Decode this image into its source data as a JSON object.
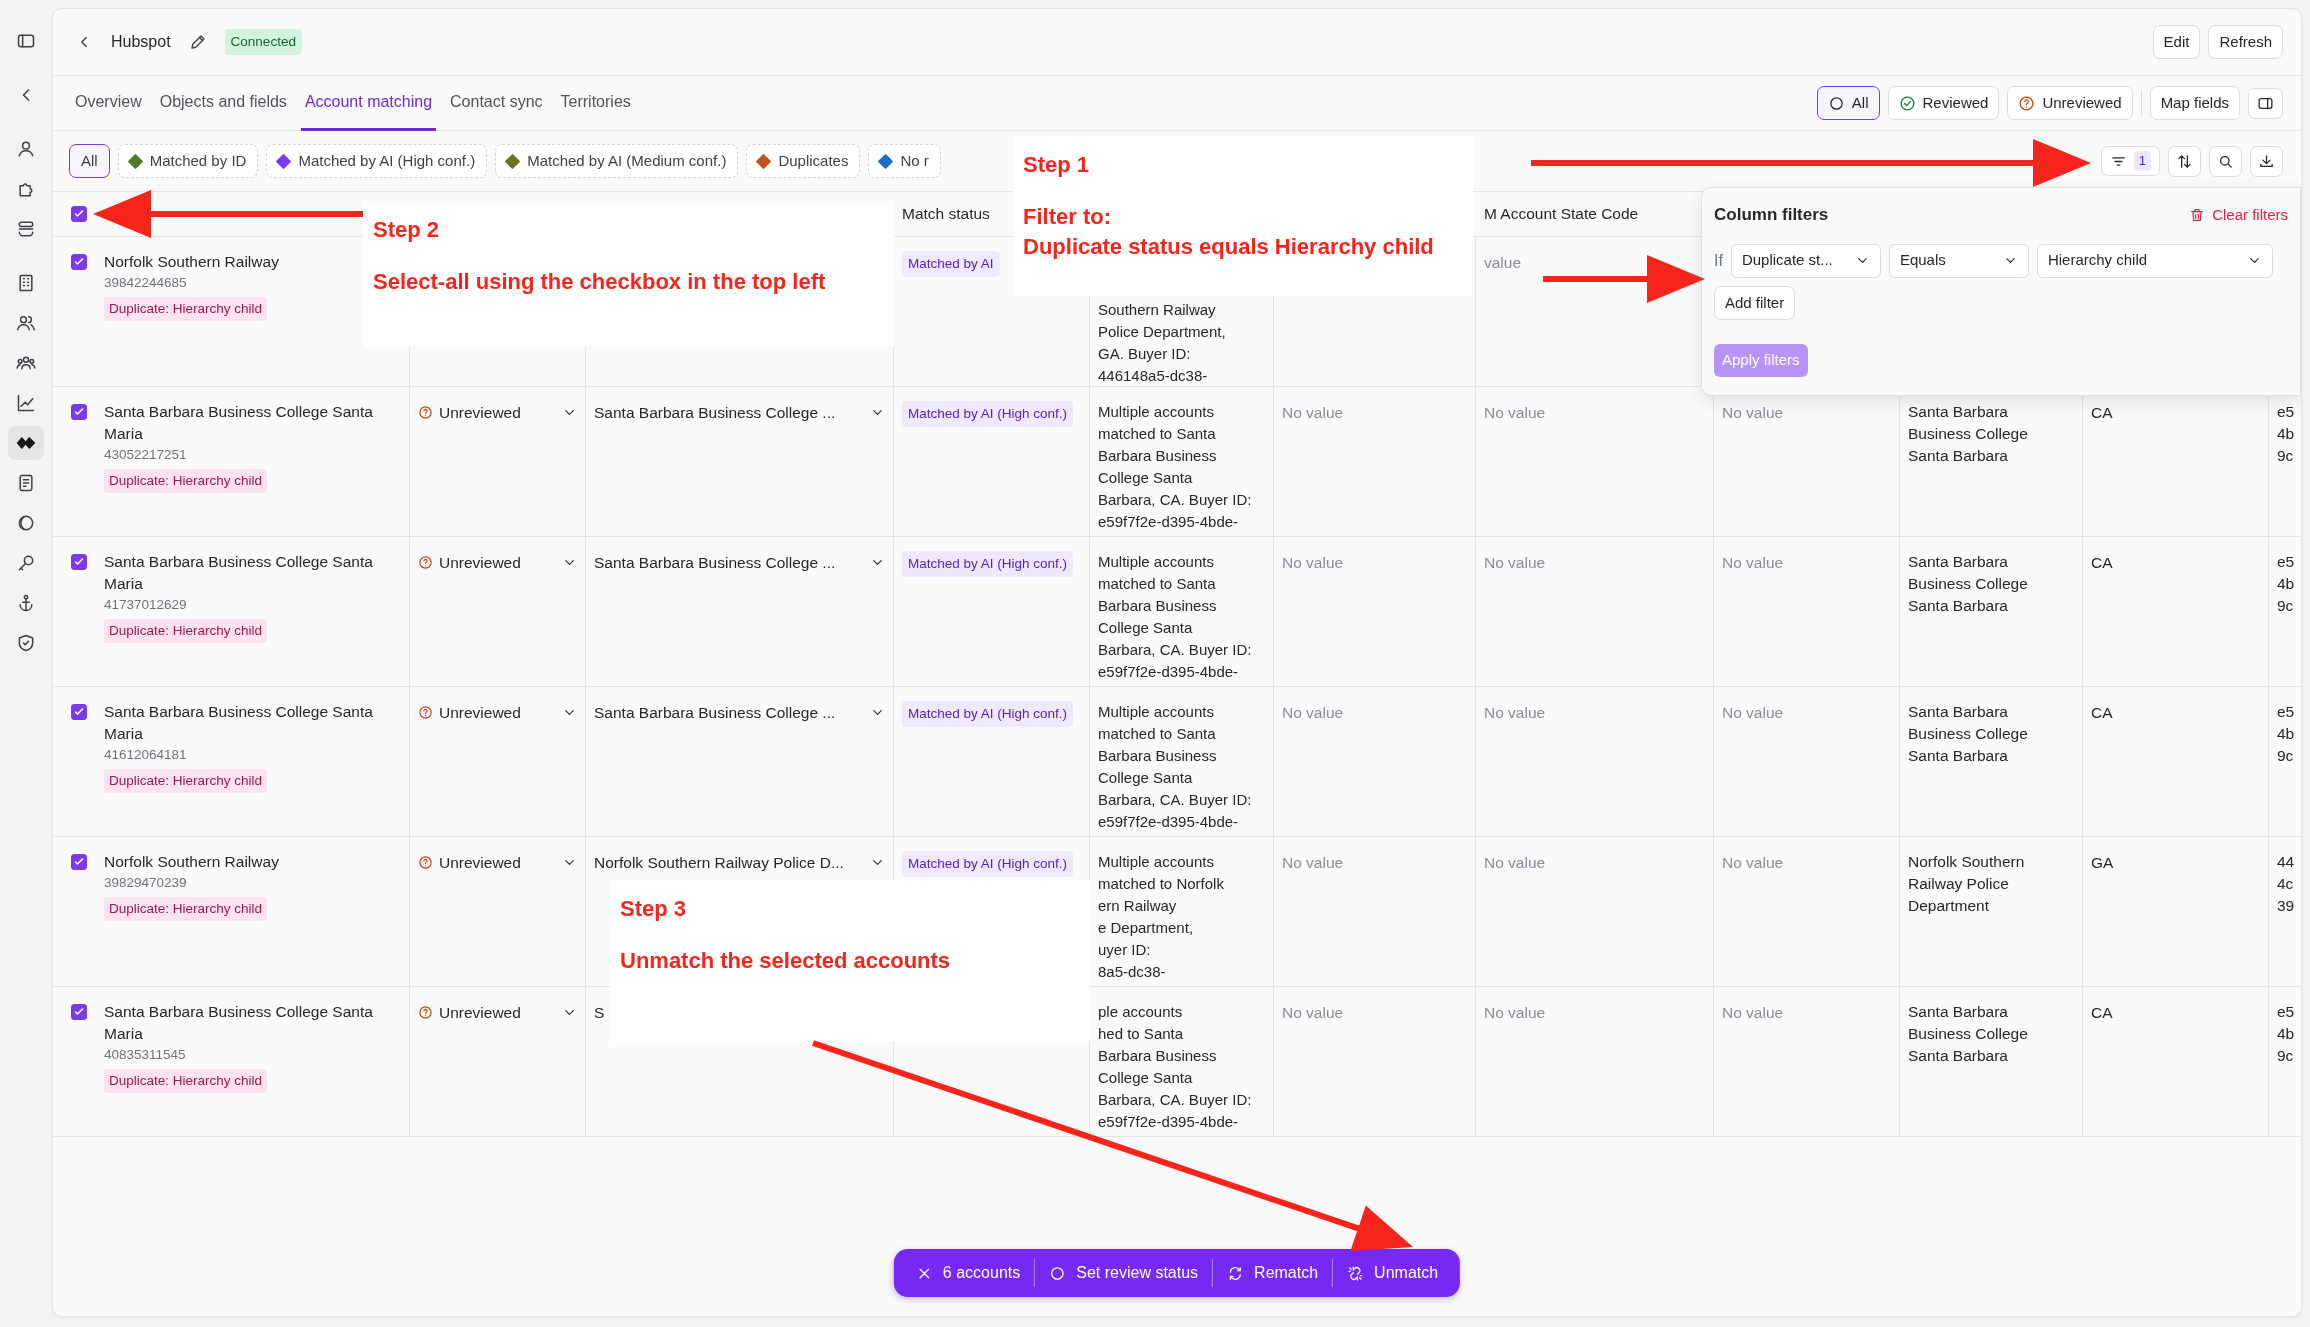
{
  "sidebar": {
    "items": [
      {
        "selected": false
      },
      {
        "selected": false
      },
      {
        "selected": false
      },
      {
        "selected": false
      },
      {
        "selected": false
      },
      {
        "selected": false
      },
      {
        "selected": false
      },
      {
        "selected": false
      },
      {
        "selected": false
      },
      {
        "selected": true
      },
      {
        "selected": false
      },
      {
        "selected": false
      },
      {
        "selected": false
      },
      {
        "selected": false
      },
      {
        "selected": false
      }
    ]
  },
  "header": {
    "title": "Hubspot",
    "status": "Connected",
    "buttons": [
      "Edit",
      "Refresh"
    ]
  },
  "tabs": [
    {
      "label": "Overview",
      "selected": false
    },
    {
      "label": "Objects and fields",
      "selected": false
    },
    {
      "label": "Account matching",
      "selected": true
    },
    {
      "label": "Contact sync",
      "selected": false
    },
    {
      "label": "Territories",
      "selected": false
    }
  ],
  "review_filter": [
    {
      "label": "All",
      "kind": "all",
      "selected": true
    },
    {
      "label": "Reviewed",
      "kind": "reviewed",
      "selected": false
    },
    {
      "label": "Unreviewed",
      "kind": "unreviewed",
      "selected": false
    }
  ],
  "map_fields": "Map fields",
  "match_chips": [
    {
      "label": "All",
      "selected": true
    },
    {
      "label": "Matched by ID",
      "color": "#4f7a28",
      "selected": false
    },
    {
      "label": "Matched by AI (High conf.)",
      "color": "#7c3aed",
      "selected": false
    },
    {
      "label": "Matched by AI (Medium conf.)",
      "color": "#6b7320",
      "selected": false
    },
    {
      "label": "Duplicates",
      "color": "#c0561c",
      "selected": false
    },
    {
      "label": "No r",
      "color": "#1d6fc4",
      "selected": false
    }
  ],
  "filter_count": "1",
  "table": {
    "select_all": {
      "checked": true
    },
    "headers": {
      "match_status": "Match status",
      "column_7": "M Account State Code"
    },
    "rows": [
      {
        "selected": true,
        "name": "Norfolk Southern Railway",
        "id": "39842244685",
        "tag": "Duplicate: Hierarchy child",
        "match_status": "Matched by AI",
        "reason": [
          "Southern Railway",
          "Police Department,",
          "GA. Buyer ID:",
          "446148a5-dc38-"
        ],
        "column_7": "value"
      },
      {
        "selected": true,
        "name": "Santa Barbara Business College Santa Maria",
        "id": "43052217251",
        "tag": "Duplicate: Hierarchy child",
        "review_status": "Unreviewed",
        "matched_account": "Santa Barbara Business College ...",
        "match_status": "Matched by AI (High conf.)",
        "reason": [
          "Multiple accounts",
          "matched to Santa",
          "Barbara Business",
          "College Santa",
          "Barbara, CA. Buyer ID:",
          "e59f7f2e-d395-4bde-"
        ],
        "column_6": "No value",
        "column_7": "No value",
        "column_8": "No value",
        "column_9": [
          "Santa Barbara",
          "Business College",
          "Santa Barbara"
        ],
        "column_10": "CA",
        "column_11": [
          "e5",
          "4b",
          "9c"
        ]
      },
      {
        "selected": true,
        "name": "Santa Barbara Business College Santa Maria",
        "id": "41737012629",
        "tag": "Duplicate: Hierarchy child",
        "review_status": "Unreviewed",
        "matched_account": "Santa Barbara Business College ...",
        "match_status": "Matched by AI (High conf.)",
        "reason": [
          "Multiple accounts",
          "matched to Santa",
          "Barbara Business",
          "College Santa",
          "Barbara, CA. Buyer ID:",
          "e59f7f2e-d395-4bde-"
        ],
        "column_6": "No value",
        "column_7": "No value",
        "column_8": "No value",
        "column_9": [
          "Santa Barbara",
          "Business College",
          "Santa Barbara"
        ],
        "column_10": "CA",
        "column_11": [
          "e5",
          "4b",
          "9c"
        ]
      },
      {
        "selected": true,
        "name": "Santa Barbara Business College Santa Maria",
        "id": "41612064181",
        "tag": "Duplicate: Hierarchy child",
        "review_status": "Unreviewed",
        "matched_account": "Santa Barbara Business College ...",
        "match_status": "Matched by AI (High conf.)",
        "reason": [
          "Multiple accounts",
          "matched to Santa",
          "Barbara Business",
          "College Santa",
          "Barbara, CA. Buyer ID:",
          "e59f7f2e-d395-4bde-"
        ],
        "column_6": "No value",
        "column_7": "No value",
        "column_8": "No value",
        "column_9": [
          "Santa Barbara",
          "Business College",
          "Santa Barbara"
        ],
        "column_10": "CA",
        "column_11": [
          "e5",
          "4b",
          "9c"
        ]
      },
      {
        "selected": true,
        "name": "Norfolk Southern Railway",
        "id": "39829470239",
        "tag": "Duplicate: Hierarchy child",
        "review_status": "Unreviewed",
        "matched_account": "Norfolk Southern Railway Police D...",
        "match_status": "Matched by AI (High conf.)",
        "reason": [
          "Multiple accounts",
          "matched to Norfolk",
          "ern Railway",
          "e Department,",
          "uyer ID:",
          "8a5-dc38-"
        ],
        "column_6": "No value",
        "column_7": "No value",
        "column_8": "No value",
        "column_9": [
          "Norfolk Southern",
          "Railway Police",
          "Department"
        ],
        "column_10": "GA",
        "column_11": [
          "44",
          "4c",
          "39"
        ]
      },
      {
        "selected": true,
        "name": "Santa Barbara Business College Santa Maria",
        "id": "40835311545",
        "tag": "Duplicate: Hierarchy child",
        "review_status": "Unreviewed",
        "matched_account_cut": "S",
        "reason": [
          "ple accounts",
          "hed to Santa",
          "Barbara Business",
          "College Santa",
          "Barbara, CA. Buyer ID:",
          "e59f7f2e-d395-4bde-"
        ],
        "column_6": "No value",
        "column_7": "No value",
        "column_8": "No value",
        "column_9": [
          "Santa Barbara",
          "Business College",
          "Santa Barbara"
        ],
        "column_10": "CA",
        "column_11": [
          "e5",
          "4b",
          "9c"
        ]
      }
    ]
  },
  "column_filters": {
    "title": "Column filters",
    "clear": "Clear filters",
    "if": "If",
    "field": "Duplicate st...",
    "operator": "Equals",
    "value": "Hierarchy child",
    "add": "Add filter",
    "apply": "Apply filters",
    "apply_disabled": true
  },
  "annotations": [
    {
      "title": "Step 1",
      "lines": [
        "Filter to:",
        "Duplicate status equals Hierarchy child"
      ]
    },
    {
      "title": "Step 2",
      "lines": [
        "Select-all using the checkbox in the top left"
      ]
    },
    {
      "title": "Step 3",
      "lines": [
        "Unmatch the selected accounts"
      ]
    }
  ],
  "bulk_bar": {
    "count": "6 accounts",
    "actions": [
      "Set review status",
      "Rematch",
      "Unmatch"
    ]
  }
}
